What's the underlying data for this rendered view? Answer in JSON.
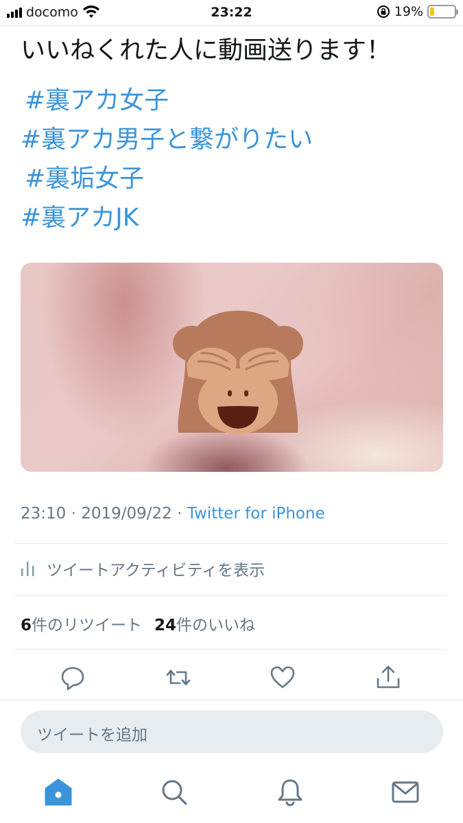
{
  "status_bar": {
    "carrier": "docomo",
    "time": "23:22",
    "battery_percent": "19%",
    "battery_level": 0.19,
    "icons": [
      "signal-icon",
      "wifi-icon",
      "orientation-lock-icon",
      "battery-icon"
    ]
  },
  "tweet": {
    "text": "いいねくれた人に動画送ります！",
    "hashtags": [
      "#裏アカ女子",
      "#裏アカ男子と繋がりたい",
      "#裏垢女子",
      "#裏アカJK"
    ],
    "media_overlay_icon": "see-no-evil-monkey-icon",
    "time": "23:10",
    "date": "2019/09/22",
    "separator": "·",
    "source": "Twitter for iPhone"
  },
  "activity": {
    "label": "ツイートアクティビティを表示",
    "icon": "bar-chart-icon"
  },
  "counts": {
    "retweet_count": "6",
    "retweet_label": "件のリツイート",
    "like_count": "24",
    "like_label": "件のいいね"
  },
  "actions": [
    "reply-icon",
    "retweet-icon",
    "like-icon",
    "share-icon"
  ],
  "reply_box": {
    "placeholder": "ツイートを追加"
  },
  "tab_bar": [
    "home-icon",
    "search-icon",
    "notifications-icon",
    "messages-icon"
  ],
  "colors": {
    "accent": "#3b94d9",
    "text": "#14171a",
    "muted": "#657786",
    "battery": "#f5c518",
    "reply_bg": "#e6ecf0"
  }
}
